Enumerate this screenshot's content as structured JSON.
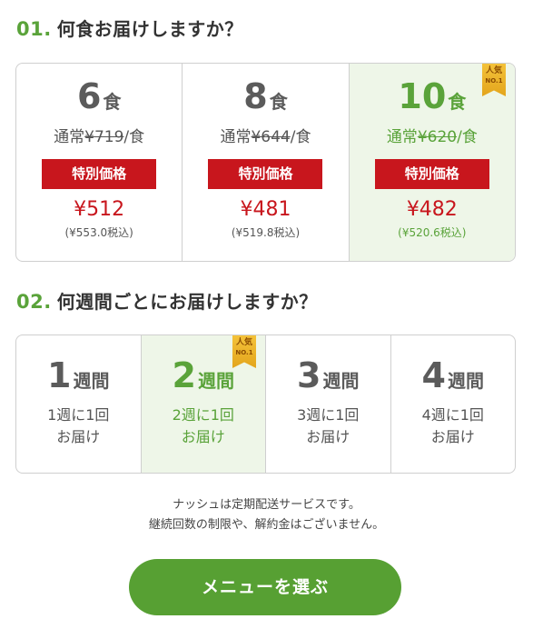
{
  "section1": {
    "number": "01.",
    "title": "何食お届けしますか？",
    "options": [
      {
        "count": "6",
        "unit": "食",
        "normal_prefix": "通常",
        "normal_price": "¥719",
        "normal_suffix": "/食",
        "special_label": "特別価格",
        "price": "¥512",
        "tax": "(¥553.0税込)",
        "badge": ""
      },
      {
        "count": "8",
        "unit": "食",
        "normal_prefix": "通常",
        "normal_price": "¥644",
        "normal_suffix": "/食",
        "special_label": "特別価格",
        "price": "¥481",
        "tax": "(¥519.8税込)",
        "badge": ""
      },
      {
        "count": "10",
        "unit": "食",
        "normal_prefix": "通常",
        "normal_price": "¥620",
        "normal_suffix": "/食",
        "special_label": "特別価格",
        "price": "¥482",
        "tax": "(¥520.6税込)",
        "badge": "人気",
        "badge_sub": "NO.1"
      }
    ],
    "selected_index": 2
  },
  "section2": {
    "number": "02.",
    "title": "何週間ごとにお届けしますか？",
    "options": [
      {
        "count": "1",
        "unit": "週間",
        "line1": "1週に1回",
        "line2": "お届け"
      },
      {
        "count": "2",
        "unit": "週間",
        "line1": "2週に1回",
        "line2": "お届け",
        "badge": "人気",
        "badge_sub": "NO.1"
      },
      {
        "count": "3",
        "unit": "週間",
        "line1": "3週に1回",
        "line2": "お届け"
      },
      {
        "count": "4",
        "unit": "週間",
        "line1": "4週に1回",
        "line2": "お届け"
      }
    ],
    "selected_index": 1
  },
  "note": {
    "line1": "ナッシュは定期配送サービスです。",
    "line2": "継続回数の制限や、解約金はございません。"
  },
  "cta_label": "メニューを選ぶ",
  "colors": {
    "accent": "#5aa33a",
    "special": "#c8161d",
    "selected_bg": "#eef6e8",
    "cta": "#57a033"
  }
}
